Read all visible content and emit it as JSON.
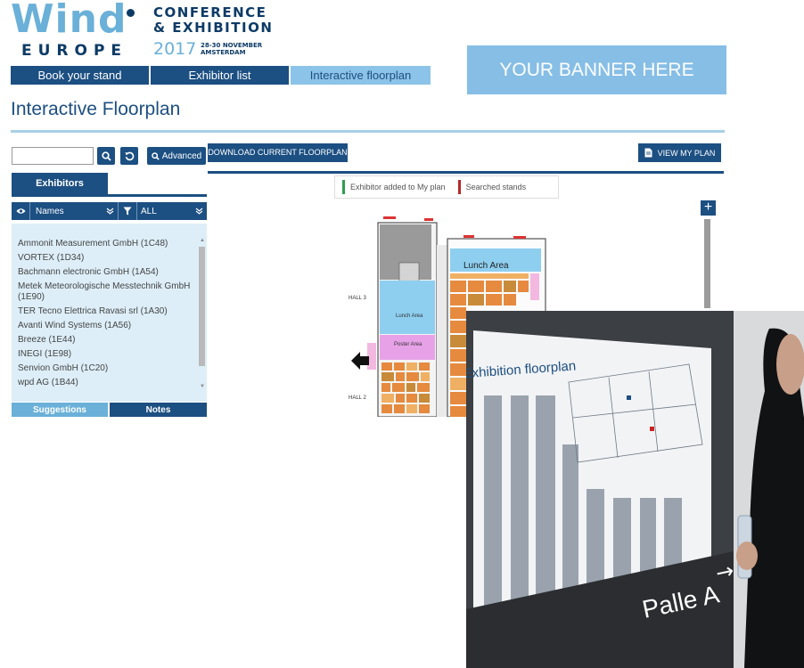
{
  "logo": {
    "wind": "Wind",
    "europe": "EUROPE",
    "conference": "CONFERENCE",
    "exhibition": "& EXHIBITION",
    "year": "2017",
    "dates": "28-30 NOVEMBER",
    "city": "AMSTERDAM"
  },
  "nav": {
    "items": [
      {
        "label": "Book your stand"
      },
      {
        "label": "Exhibitor list"
      },
      {
        "label": "Interactive floorplan"
      }
    ]
  },
  "banner": {
    "label": "YOUR BANNER HERE"
  },
  "page": {
    "title": "Interactive Floorplan"
  },
  "search": {
    "placeholder": "",
    "advanced_label": "Advanced"
  },
  "tabs": {
    "exhibitors": "Exhibitors"
  },
  "filter": {
    "names_label": "Names",
    "all_label": "ALL"
  },
  "exhibitors": [
    "Ammonit Measurement GmbH (1C48)",
    "VORTEX (1D34)",
    "Bachmann electronic GmbH (1A54)",
    "Metek Meteorologische Messtechnik GmbH (1E90)",
    "TER Tecno Elettrica Ravasi srl (1A30)",
    "Avanti Wind Systems (1A56)",
    "Breeze (1E44)",
    "INEGI (1E98)",
    "Senvion GmbH (1C20)",
    "wpd AG (1B44)"
  ],
  "bottom_tabs": {
    "suggestions": "Suggestions",
    "notes": "Notes"
  },
  "floorplan": {
    "download_label": "DOWNLOAD CURRENT FLOORPLAN",
    "view_plan_label": "VIEW MY PLAN",
    "legend_added": "Exhibitor added to My plan",
    "legend_searched": "Searched stands",
    "zoom_label": "+",
    "hall3": "HALL 3",
    "hall2": "HALL 2",
    "lunch_area_large": "Lunch Area",
    "lunch_area_small": "Lunch Area",
    "poster_area": "Poster Area"
  },
  "photo": {
    "board_title": "Exhibition floorplan",
    "sign": "Palle A"
  },
  "colors": {
    "navy": "#1c4f82",
    "light_blue": "#8cc3e8",
    "banner": "#86bee6",
    "legend_green": "#2e9e4f",
    "legend_red": "#b52a2a"
  }
}
